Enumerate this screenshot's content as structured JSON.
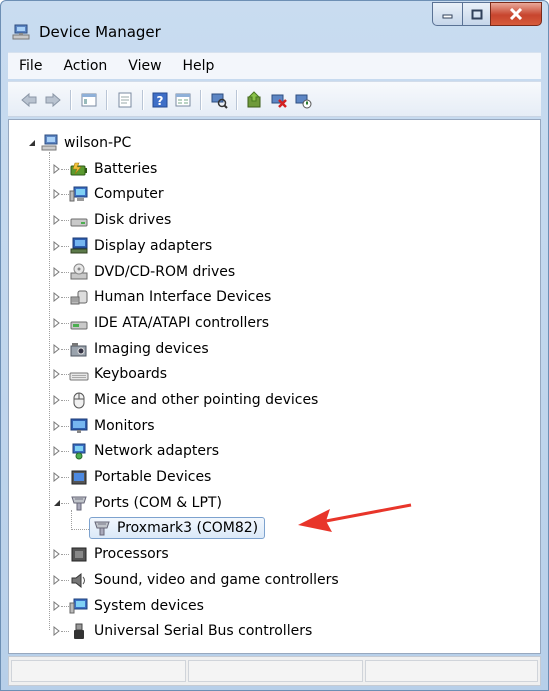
{
  "window": {
    "title": "Device Manager"
  },
  "menu": [
    "File",
    "Action",
    "View",
    "Help"
  ],
  "toolbar": {
    "icons": [
      "back-arrow-icon",
      "forward-arrow-icon",
      "show-hide-tree-icon",
      "properties-icon",
      "help-icon",
      "grid-view-icon",
      "scan-hardware-icon",
      "update-driver-icon",
      "uninstall-icon",
      "disable-icon"
    ]
  },
  "tree": {
    "root": "wilson-PC",
    "categories": [
      {
        "label": "Batteries",
        "icon": "battery-icon"
      },
      {
        "label": "Computer",
        "icon": "computer-icon"
      },
      {
        "label": "Disk drives",
        "icon": "disk-drive-icon"
      },
      {
        "label": "Display adapters",
        "icon": "display-adapter-icon"
      },
      {
        "label": "DVD/CD-ROM drives",
        "icon": "dvd-drive-icon"
      },
      {
        "label": "Human Interface Devices",
        "icon": "hid-icon"
      },
      {
        "label": "IDE ATA/ATAPI controllers",
        "icon": "ide-controller-icon"
      },
      {
        "label": "Imaging devices",
        "icon": "imaging-device-icon"
      },
      {
        "label": "Keyboards",
        "icon": "keyboard-icon"
      },
      {
        "label": "Mice and other pointing devices",
        "icon": "mouse-icon"
      },
      {
        "label": "Monitors",
        "icon": "monitor-icon"
      },
      {
        "label": "Network adapters",
        "icon": "network-adapter-icon"
      },
      {
        "label": "Portable Devices",
        "icon": "portable-device-icon"
      },
      {
        "label": "Ports (COM & LPT)",
        "icon": "port-icon",
        "expanded": true,
        "children": [
          {
            "label": "Proxmark3 (COM82)",
            "icon": "port-icon",
            "selected": true
          }
        ]
      },
      {
        "label": "Processors",
        "icon": "processor-icon"
      },
      {
        "label": "Sound, video and game controllers",
        "icon": "sound-icon"
      },
      {
        "label": "System devices",
        "icon": "system-device-icon"
      },
      {
        "label": "Universal Serial Bus controllers",
        "icon": "usb-icon"
      }
    ]
  },
  "colors": {
    "selection_border": "#7da2ce",
    "annotation_arrow": "#e8352a"
  }
}
